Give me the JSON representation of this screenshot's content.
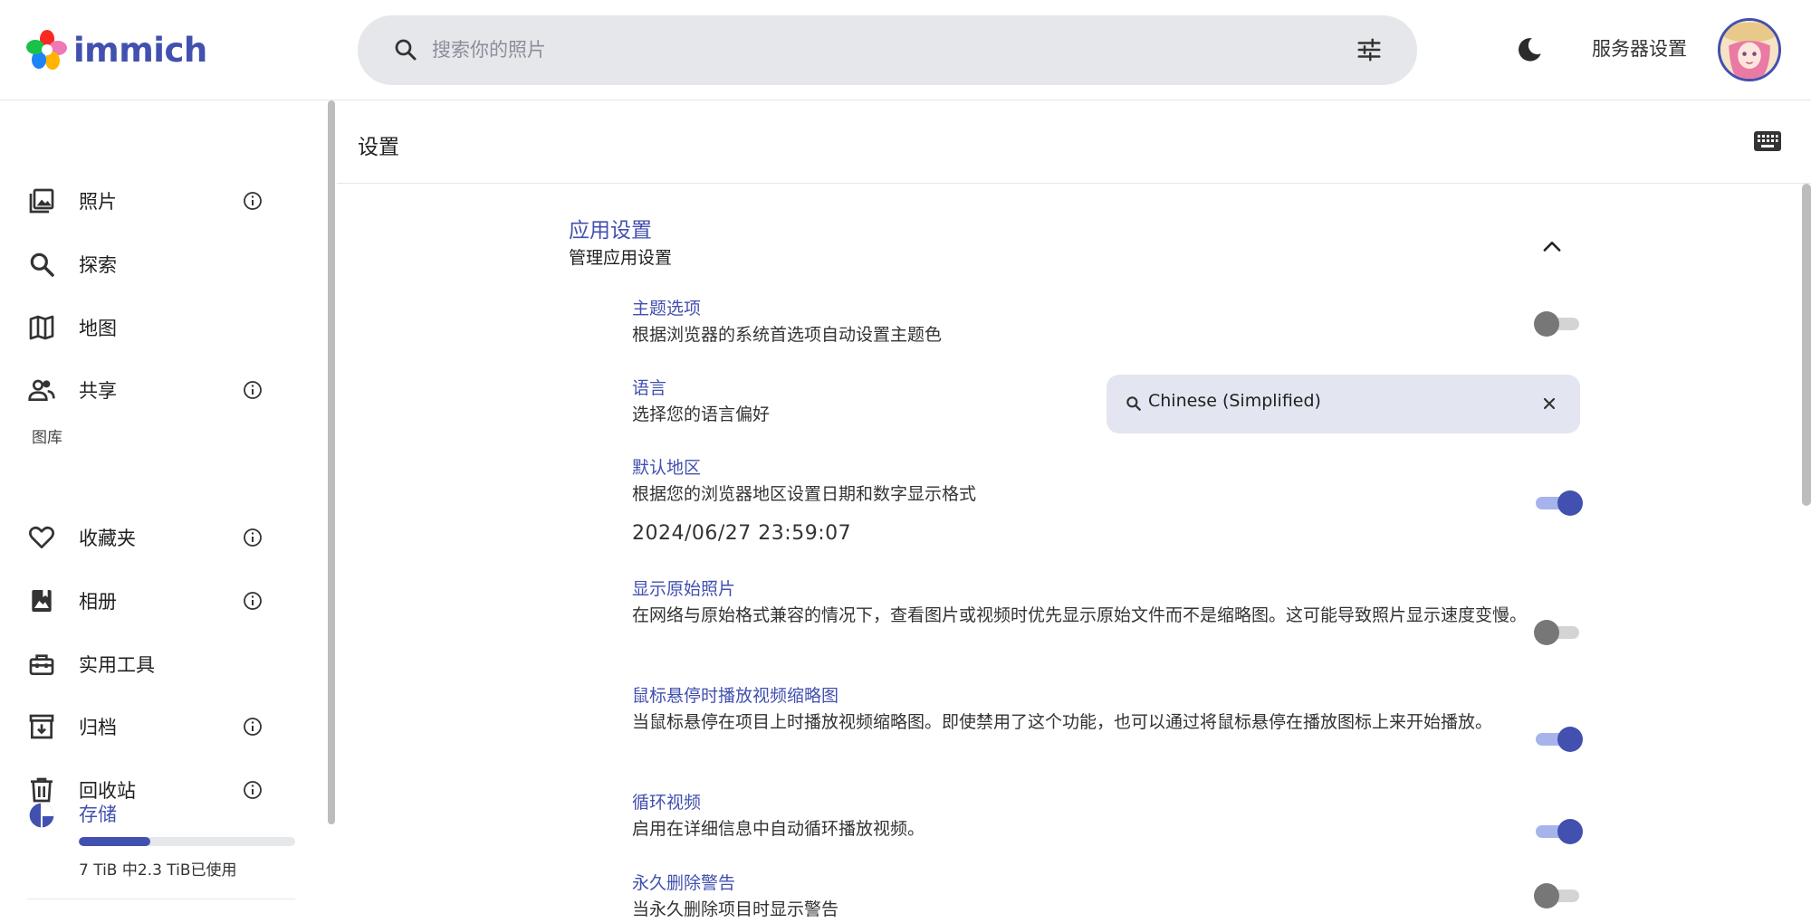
{
  "app": {
    "name": "immich"
  },
  "header": {
    "search_placeholder": "搜索你的照片",
    "server_settings": "服务器设置"
  },
  "sidebar": {
    "items": [
      {
        "label": "照片",
        "icon": "photos-icon",
        "info": true
      },
      {
        "label": "探索",
        "icon": "search-icon",
        "info": false
      },
      {
        "label": "地图",
        "icon": "map-icon",
        "info": false
      },
      {
        "label": "共享",
        "icon": "people-icon",
        "info": true
      }
    ],
    "library_label": "图库",
    "library_items": [
      {
        "label": "收藏夹",
        "icon": "heart-icon",
        "info": true
      },
      {
        "label": "相册",
        "icon": "album-icon",
        "info": true
      },
      {
        "label": "实用工具",
        "icon": "toolbox-icon",
        "info": false
      },
      {
        "label": "归档",
        "icon": "archive-icon",
        "info": true
      },
      {
        "label": "回收站",
        "icon": "trash-icon",
        "info": true
      }
    ],
    "storage": {
      "label": "存储",
      "used_fraction": 0.33,
      "text": "7 TiB 中2.3 TiB已使用"
    }
  },
  "main": {
    "title": "设置",
    "section": {
      "title": "应用设置",
      "subtitle": "管理应用设置"
    },
    "settings": [
      {
        "title": "主题选项",
        "desc": "根据浏览器的系统首选项自动设置主题色",
        "toggle": false
      },
      {
        "title": "语言",
        "desc": "选择您的语言偏好",
        "select_value": "Chinese (Simplified)"
      },
      {
        "title": "默认地区",
        "desc": "根据您的浏览器地区设置日期和数字显示格式",
        "toggle": true,
        "extra": "2024/06/27 23:59:07"
      },
      {
        "title": "显示原始照片",
        "desc": "在网络与原始格式兼容的情况下，查看图片或视频时优先显示原始文件而不是缩略图。这可能导致照片显示速度变慢。",
        "toggle": false
      },
      {
        "title": "鼠标悬停时播放视频缩略图",
        "desc": "当鼠标悬停在项目上时播放视频缩略图。即使禁用了这个功能，也可以通过将鼠标悬停在播放图标上来开始播放。",
        "toggle": true
      },
      {
        "title": "循环视频",
        "desc": "启用在详细信息中自动循环播放视频。",
        "toggle": true
      },
      {
        "title": "永久删除警告",
        "desc": "当永久删除项目时显示警告",
        "toggle": false
      }
    ]
  },
  "colors": {
    "accent": "#4250af",
    "toggle_off": "#777777",
    "surface": "#e5e7eb"
  }
}
